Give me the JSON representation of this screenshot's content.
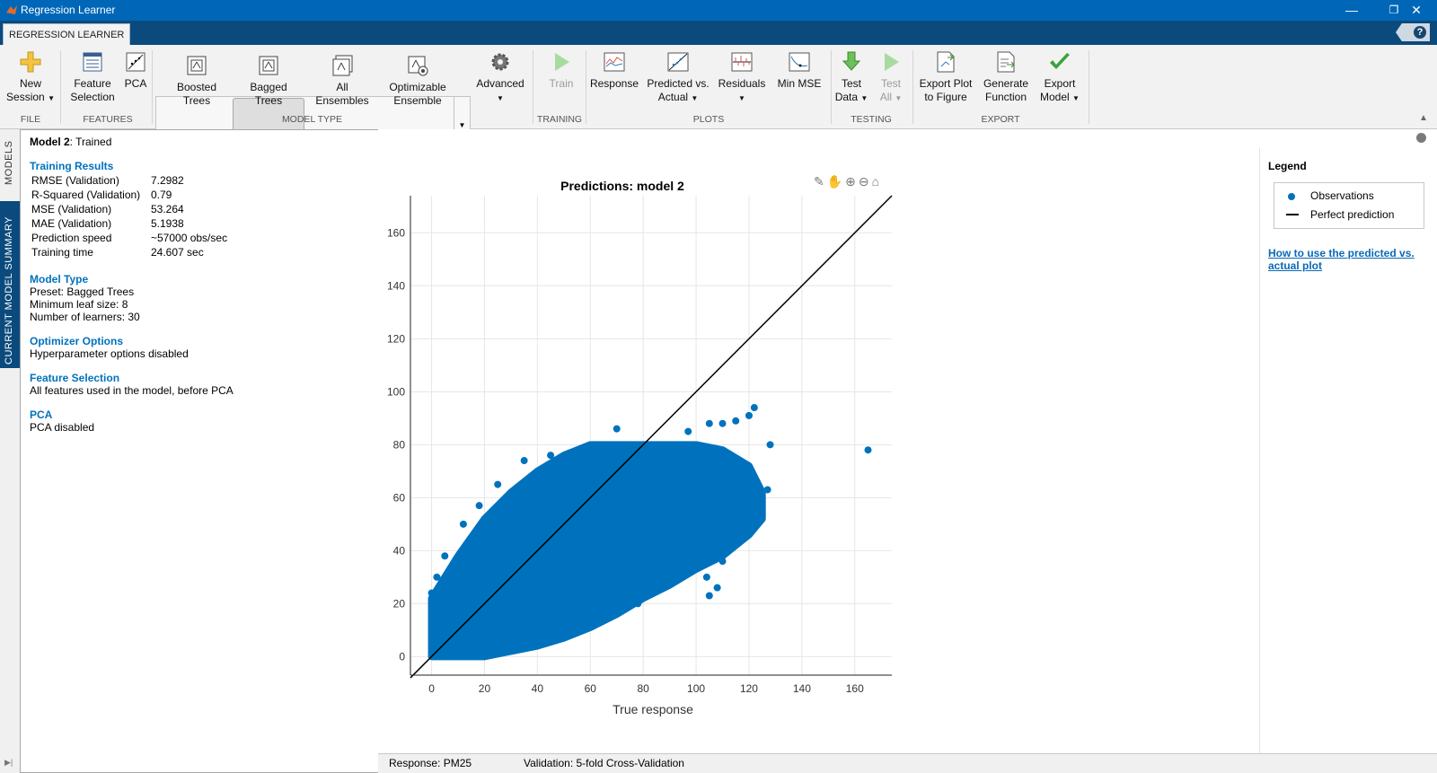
{
  "window": {
    "title": "Regression Learner",
    "min": "—",
    "restore": "❐",
    "close": "✕"
  },
  "tab": {
    "label": "REGRESSION LEARNER",
    "help": "?"
  },
  "ribbon": {
    "new_session": [
      "New",
      "Session"
    ],
    "feature_selection": [
      "Feature",
      "Selection"
    ],
    "pca": "PCA",
    "boosted_trees": [
      "Boosted",
      "Trees"
    ],
    "bagged_trees": [
      "Bagged",
      "Trees"
    ],
    "all_ensembles": [
      "All",
      "Ensembles"
    ],
    "optimizable_ensemble": [
      "Optimizable",
      "Ensemble"
    ],
    "advanced": "Advanced",
    "train": "Train",
    "response": "Response",
    "predicted_vs_actual": [
      "Predicted vs.",
      "Actual"
    ],
    "residuals": "Residuals",
    "min_mse": "Min MSE",
    "test_data": [
      "Test",
      "Data"
    ],
    "test_all": [
      "Test",
      "All"
    ],
    "export_plot": [
      "Export Plot",
      "to Figure"
    ],
    "generate_function": [
      "Generate",
      "Function"
    ],
    "export_model": [
      "Export",
      "Model"
    ],
    "sections": {
      "file": "FILE",
      "features": "FEATURES",
      "model_type": "MODEL TYPE",
      "training": "TRAINING",
      "plots": "PLOTS",
      "testing": "TESTING",
      "export": "EXPORT"
    }
  },
  "side_tabs": {
    "models": "MODELS",
    "summary": "CURRENT MODEL SUMMARY"
  },
  "summary": {
    "model_name": "Model 2",
    "model_status": ": Trained",
    "training_results_header": "Training Results",
    "metrics": [
      {
        "label": "RMSE (Validation)",
        "value": "7.2982"
      },
      {
        "label": "R-Squared (Validation)",
        "value": "0.79"
      },
      {
        "label": "MSE (Validation)",
        "value": "53.264"
      },
      {
        "label": "MAE (Validation)",
        "value": "5.1938"
      },
      {
        "label": "Prediction speed",
        "value": "~57000 obs/sec"
      },
      {
        "label": "Training time",
        "value": "24.607 sec"
      }
    ],
    "model_type_header": "Model Type",
    "model_type_lines": [
      "Preset: Bagged Trees",
      "Minimum leaf size: 8",
      "Number of learners: 30"
    ],
    "optimizer_header": "Optimizer Options",
    "optimizer_text": "Hyperparameter options disabled",
    "feature_selection_header": "Feature Selection",
    "feature_selection_text": "All features used in the model, before PCA",
    "pca_header": "PCA",
    "pca_text": "PCA disabled"
  },
  "legend": {
    "title": "Legend",
    "observations": "Observations",
    "perfect": "Perfect prediction",
    "help_link": "How to use the predicted vs. actual plot"
  },
  "status": {
    "response": "Response: PM25",
    "validation": "Validation: 5-fold Cross-Validation"
  },
  "chart_data": {
    "type": "scatter",
    "title": "Predictions: model 2",
    "xlabel": "True response",
    "ylabel": "",
    "xlim": [
      -8,
      174
    ],
    "ylim": [
      -7,
      174
    ],
    "xticks": [
      0,
      20,
      40,
      60,
      80,
      100,
      120,
      140,
      160
    ],
    "yticks": [
      0,
      20,
      40,
      60,
      80,
      100,
      120,
      140,
      160
    ],
    "grid": true,
    "marker_color": "#0072bd",
    "line_color": "#000000",
    "series": [
      {
        "name": "Observations",
        "kind": "points",
        "note_cloud_upper": [
          [
            0,
            22
          ],
          [
            10,
            38
          ],
          [
            20,
            52
          ],
          [
            30,
            62
          ],
          [
            40,
            70
          ],
          [
            50,
            76
          ],
          [
            60,
            80
          ],
          [
            70,
            80
          ],
          [
            80,
            80
          ],
          [
            90,
            80
          ],
          [
            100,
            80
          ],
          [
            110,
            78
          ],
          [
            120,
            72
          ],
          [
            125,
            62
          ],
          [
            125,
            52
          ],
          [
            120,
            46
          ],
          [
            110,
            38
          ],
          [
            100,
            33
          ],
          [
            90,
            27
          ],
          [
            80,
            22
          ],
          [
            70,
            16
          ],
          [
            60,
            11
          ],
          [
            50,
            7
          ],
          [
            40,
            4
          ],
          [
            30,
            2
          ],
          [
            20,
            0
          ],
          [
            10,
            0
          ],
          [
            0,
            0
          ]
        ],
        "outliers": [
          [
            165,
            78
          ],
          [
            128,
            80
          ],
          [
            127,
            63
          ],
          [
            120,
            62
          ],
          [
            122,
            94
          ],
          [
            108,
            26
          ],
          [
            105,
            23
          ],
          [
            104,
            30
          ],
          [
            120,
            91
          ],
          [
            115,
            89
          ],
          [
            110,
            88
          ],
          [
            105,
            88
          ],
          [
            97,
            85
          ],
          [
            88,
            80
          ],
          [
            85,
            78
          ],
          [
            70,
            86
          ],
          [
            65,
            80
          ],
          [
            55,
            78
          ],
          [
            45,
            76
          ],
          [
            35,
            74
          ],
          [
            25,
            65
          ],
          [
            18,
            57
          ],
          [
            12,
            50
          ],
          [
            5,
            38
          ],
          [
            2,
            30
          ],
          [
            0,
            24
          ],
          [
            95,
            40
          ],
          [
            94,
            38
          ],
          [
            92,
            34
          ],
          [
            85,
            30
          ],
          [
            80,
            24
          ],
          [
            78,
            20
          ],
          [
            110,
            36
          ],
          [
            112,
            42
          ],
          [
            100,
            44
          ],
          [
            98,
            50
          ],
          [
            102,
            46
          ],
          [
            116,
            60
          ],
          [
            118,
            70
          ],
          [
            123,
            56
          ]
        ]
      },
      {
        "name": "Perfect prediction",
        "kind": "line",
        "points": [
          [
            -8,
            -8
          ],
          [
            174,
            174
          ]
        ]
      }
    ]
  }
}
